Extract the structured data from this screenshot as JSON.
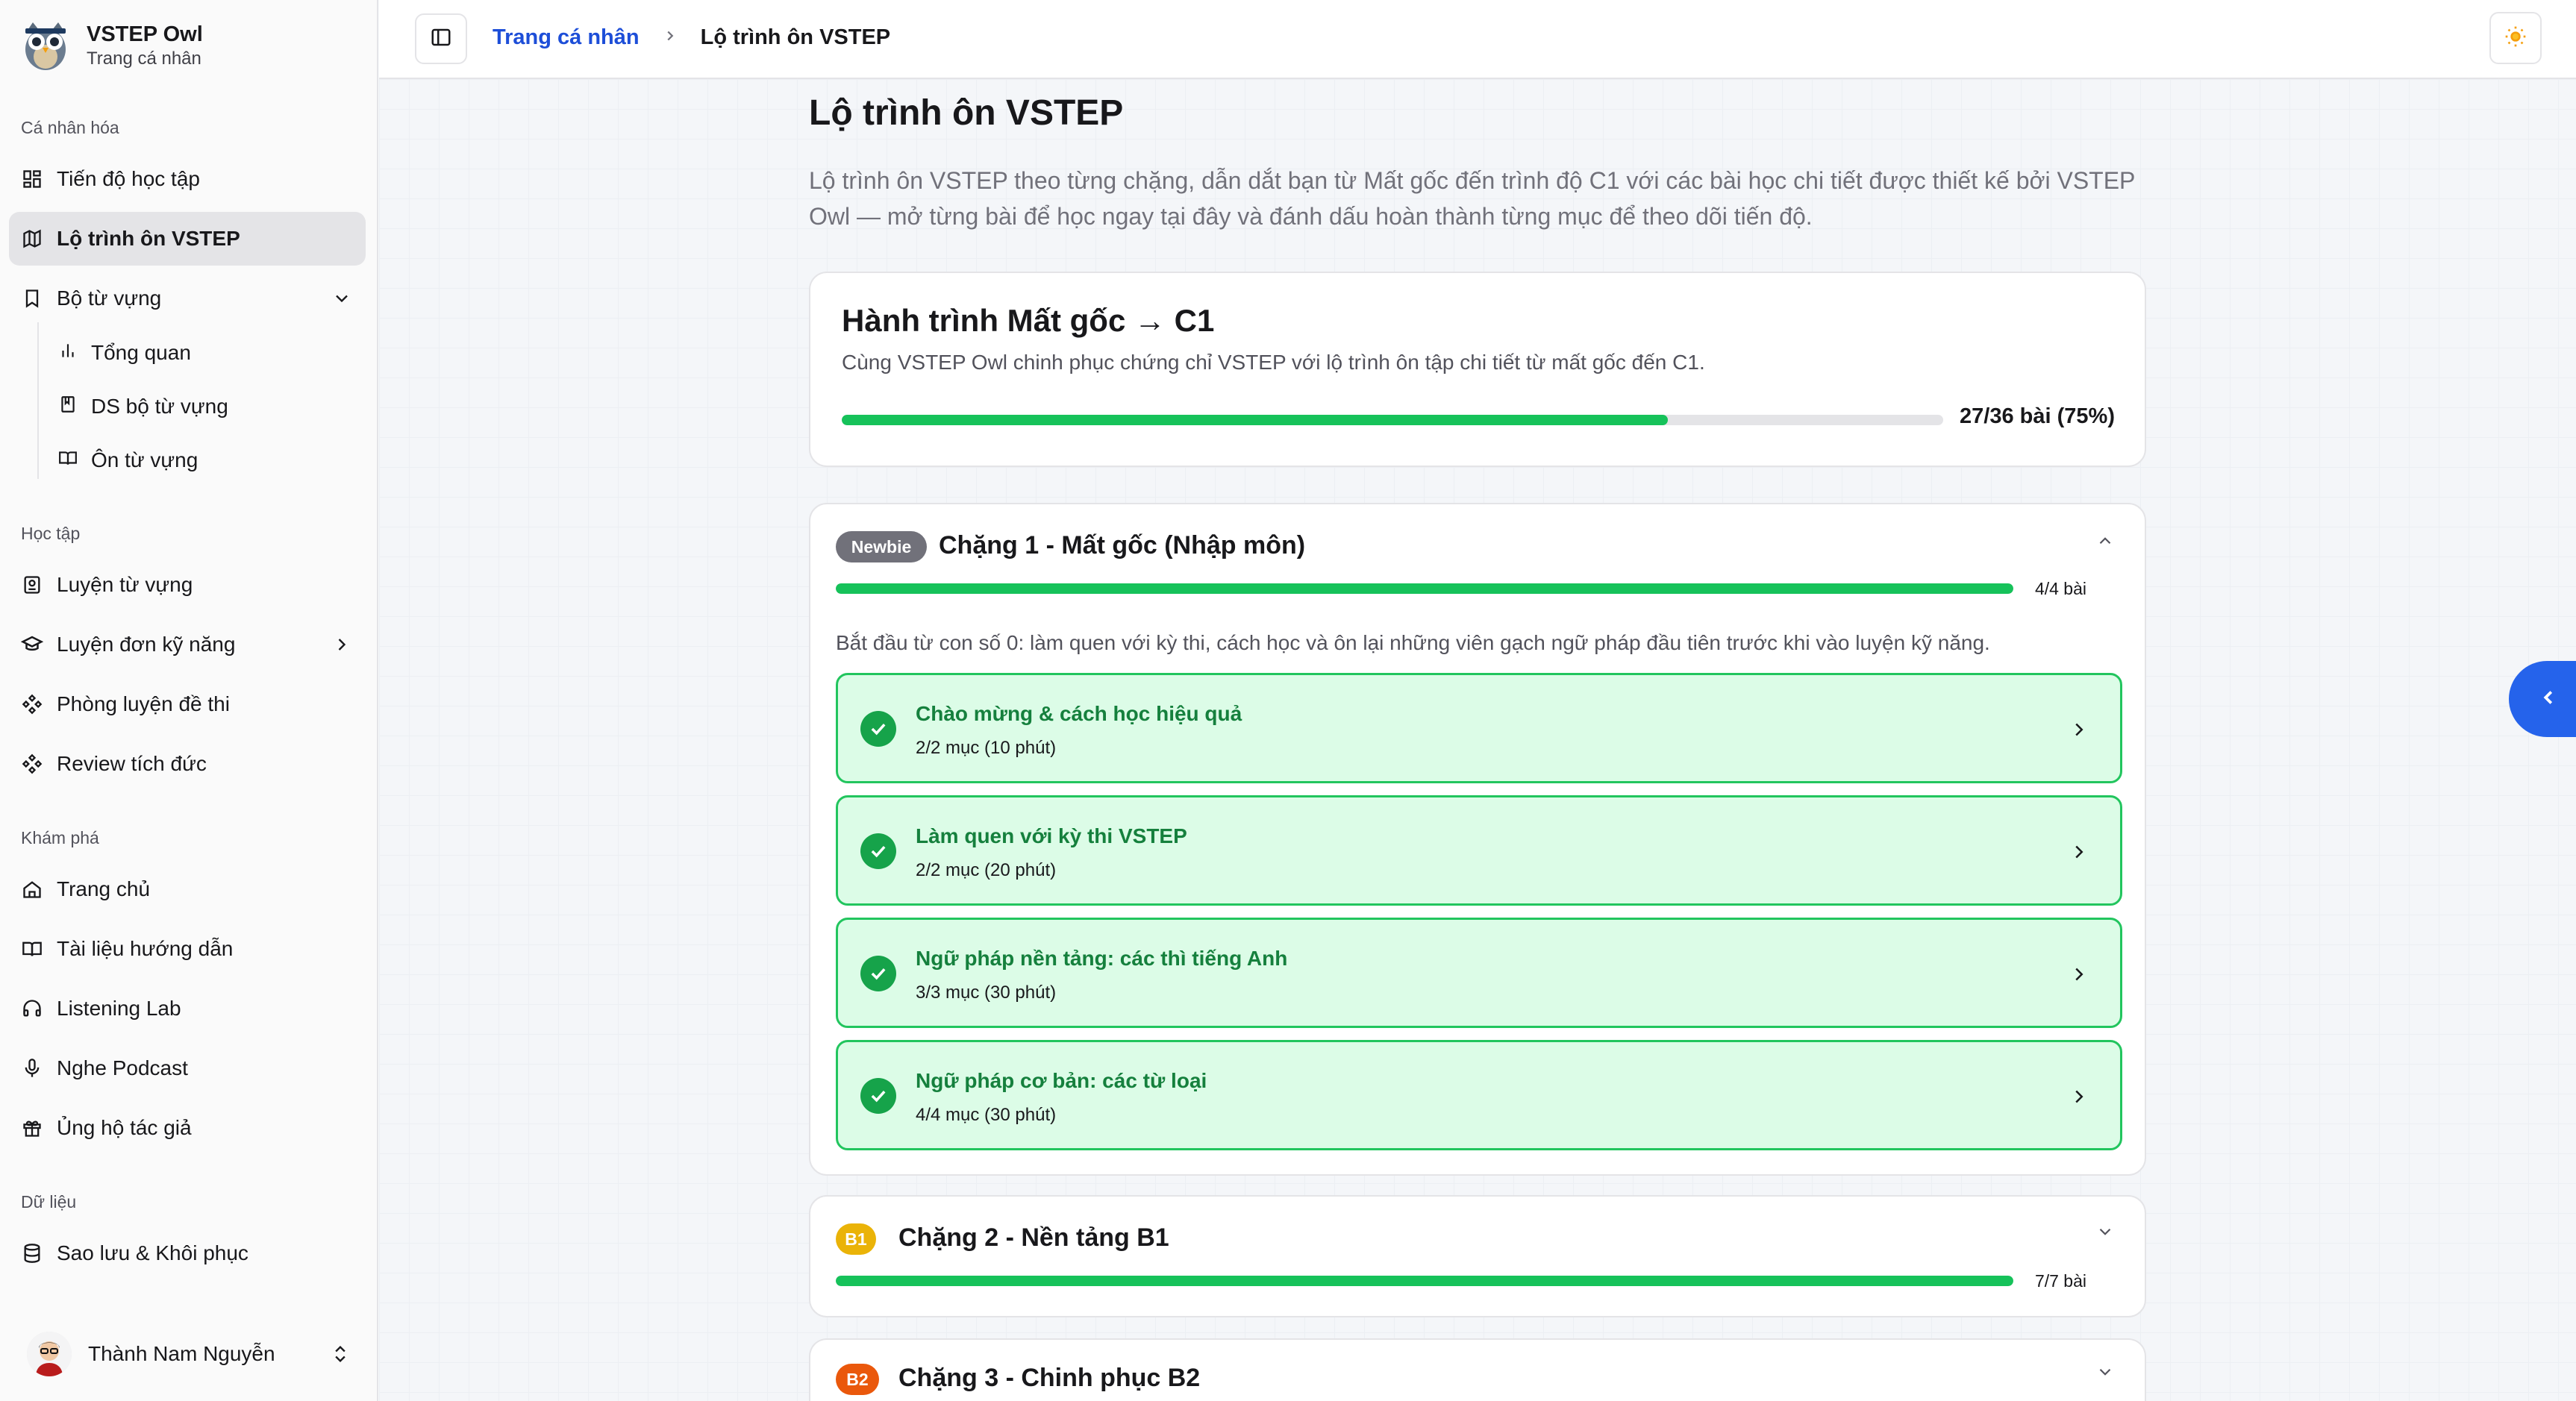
{
  "app": {
    "name": "VSTEP Owl",
    "subtitle": "Trang cá nhân"
  },
  "sidebar": {
    "groups": [
      {
        "label": "Cá nhân hóa"
      },
      {
        "label": "Học tập"
      },
      {
        "label": "Khám phá"
      },
      {
        "label": "Dữ liệu"
      }
    ],
    "items": {
      "progress": "Tiến độ học tập",
      "roadmap": "Lộ trình ôn VSTEP",
      "vocab_sets": "Bộ từ vựng",
      "overview": "Tổng quan",
      "set_list": "DS bộ từ vựng",
      "review_vocab": "Ôn từ vựng",
      "practice_vocab": "Luyện từ vựng",
      "single_skill": "Luyện đơn kỹ năng",
      "exam_room": "Phòng luyện đề thi",
      "review_acc": "Review tích đức",
      "home": "Trang chủ",
      "docs": "Tài liệu hướng dẫn",
      "listening_lab": "Listening Lab",
      "podcast": "Nghe Podcast",
      "support": "Ủng hộ tác giả",
      "backup": "Sao lưu & Khôi phục"
    },
    "user": {
      "name": "Thành Nam Nguyễn"
    }
  },
  "topbar": {
    "breadcrumb": {
      "parent": "Trang cá nhân",
      "current": "Lộ trình ôn VSTEP"
    }
  },
  "page": {
    "title": "Lộ trình ôn VSTEP",
    "description": "Lộ trình ôn VSTEP theo từng chặng, dẫn dắt bạn từ Mất gốc đến trình độ C1 với các bài học chi tiết được thiết kế bởi VSTEP Owl — mở từng bài để học ngay tại đây và đánh dấu hoàn thành từng mục để theo dõi tiến độ."
  },
  "journey": {
    "title": "Hành trình Mất gốc → C1",
    "subtitle": "Cùng VSTEP Owl chinh phục chứng chỉ VSTEP với lộ trình ôn tập chi tiết từ mất gốc đến C1.",
    "progress": 0.75,
    "count": "27/36 bài (75%)"
  },
  "stages": [
    {
      "badge": "Newbie",
      "badge_color": "#71717a",
      "title": "Chặng 1 - Mất gốc (Nhập môn)",
      "count": "4/4 bài",
      "progress": 1.0,
      "description": "Bắt đầu từ con số 0: làm quen với kỳ thi, cách học và ôn lại những viên gạch ngữ pháp đầu tiên trước khi vào luyện kỹ năng.",
      "lessons": [
        {
          "title": "Chào mừng & cách học hiệu quả",
          "meta": "2/2 mục (10 phút)"
        },
        {
          "title": "Làm quen với kỳ thi VSTEP",
          "meta": "2/2 mục (20 phút)"
        },
        {
          "title": "Ngữ pháp nền tảng: các thì tiếng Anh",
          "meta": "3/3 mục (30 phút)"
        },
        {
          "title": "Ngữ pháp cơ bản: các từ loại",
          "meta": "4/4 mục (30 phút)"
        }
      ]
    },
    {
      "badge": "B1",
      "badge_color": "#eab308",
      "title": "Chặng 2 - Nền tảng B1",
      "count": "7/7 bài",
      "progress": 1.0
    },
    {
      "badge": "B2",
      "badge_color": "#ea580c",
      "title": "Chặng 3 - Chinh phục B2"
    }
  ],
  "colors": {
    "accent": "#16c25a",
    "link": "#1d4ed8",
    "lesson_bg": "#dcfce7",
    "lesson_border": "#22c55e"
  }
}
